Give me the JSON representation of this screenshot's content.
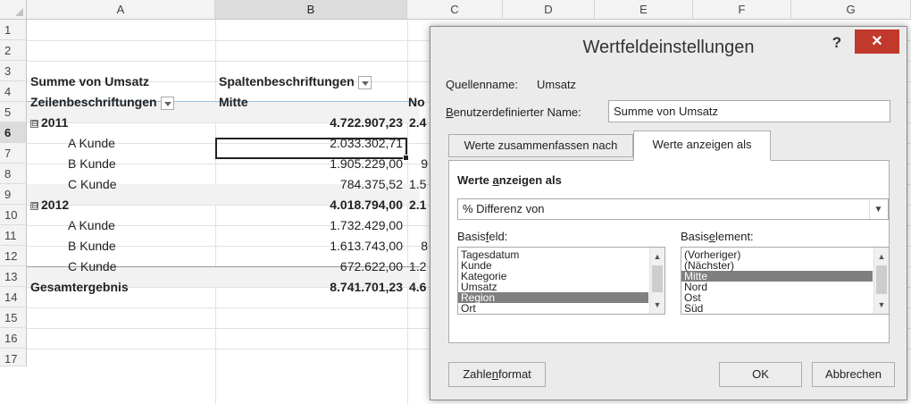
{
  "sheet": {
    "columns": [
      "A",
      "B",
      "C",
      "D",
      "E",
      "F",
      "G"
    ],
    "rows": [
      "1",
      "2",
      "3",
      "4",
      "5",
      "6",
      "7",
      "8",
      "9",
      "10",
      "11",
      "12",
      "13",
      "14",
      "15",
      "16",
      "17"
    ],
    "a3": "Summe von Umsatz",
    "b3": "Spaltenbeschriftungen",
    "a4": "Zeilenbeschriftungen",
    "b4": "Mitte",
    "c4": "No",
    "a5": "2011",
    "b5": "4.722.907,23",
    "c5": "2.4",
    "a6": "A Kunde",
    "b6": "2.033.302,71",
    "a7": "B Kunde",
    "b7": "1.905.229,00",
    "c7": "9",
    "a8": "C Kunde",
    "b8": "784.375,52",
    "c8": "1.5",
    "a9": "2012",
    "b9": "4.018.794,00",
    "c9": "2.1",
    "a10": "A Kunde",
    "b10": "1.732.429,00",
    "a11": "B Kunde",
    "b11": "1.613.743,00",
    "c11": "8",
    "a12": "C Kunde",
    "b12": "672.622,00",
    "c12": "1.2",
    "a13": "Gesamtergebnis",
    "b13": "8.741.701,23",
    "c13": "4.6",
    "collapse_glyph": "⊟"
  },
  "dialog": {
    "title": "Wertfeldeinstellungen",
    "help": "?",
    "close": "✕",
    "source_label": "Quellenname:",
    "source_value": "Umsatz",
    "custom_name_label_u": "B",
    "custom_name_label_rest": "enutzerdefinierter Name:",
    "custom_name_value": "Summe von Umsatz",
    "tab1": "Werte zusammenfassen nach",
    "tab2": "Werte anzeigen als",
    "section_a": "Werte ",
    "section_u": "a",
    "section_b": "nzeigen als",
    "calc_value": "% Differenz von",
    "basefield_a": "Basis",
    "basefield_u": "f",
    "basefield_b": "eld:",
    "baseitem_a": "Basis",
    "baseitem_u": "e",
    "baseitem_b": "lement:",
    "base_fields": [
      "Tagesdatum",
      "Kunde",
      "Kategorie",
      "Umsatz",
      "Region",
      "Ort"
    ],
    "base_field_selected": "Region",
    "base_items": [
      "(Vorheriger)",
      "(Nächster)",
      "Mitte",
      "Nord",
      "Ost",
      "Süd"
    ],
    "base_item_selected": "Mitte",
    "numfmt_a": "Zahle",
    "numfmt_u": "n",
    "numfmt_b": "format",
    "ok": "OK",
    "cancel": "Abbrechen"
  }
}
